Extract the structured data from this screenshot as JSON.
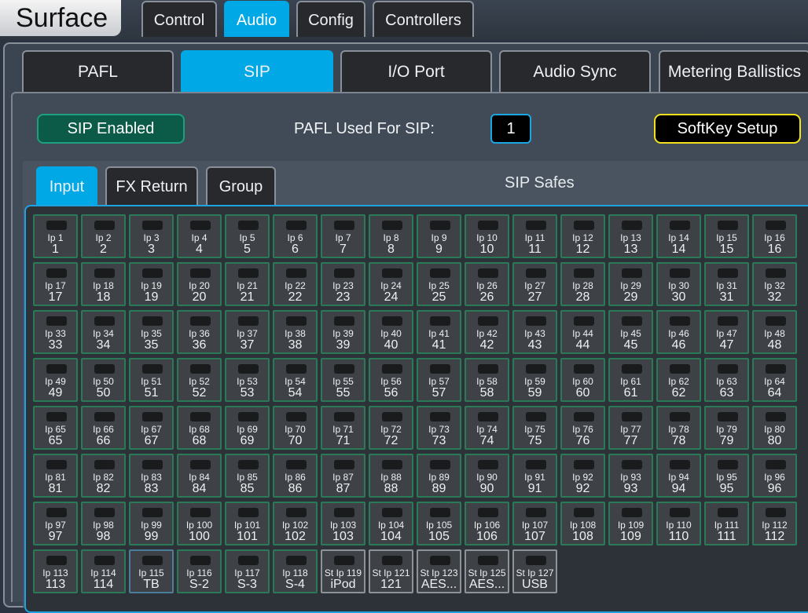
{
  "app": {
    "title": "Surface"
  },
  "top_tabs": [
    "Control",
    "Audio",
    "Config",
    "Controllers"
  ],
  "sub_tabs": [
    "PAFL",
    "SIP",
    "I/O Port",
    "Audio Sync",
    "Metering Ballistics"
  ],
  "sip": {
    "enabled_label": "SIP Enabled",
    "pafl_label": "PAFL Used For SIP:",
    "pafl_value": "1",
    "softkey_label": "SoftKey Setup"
  },
  "safes": {
    "tabs": [
      "Input",
      "FX Return",
      "Group"
    ],
    "title": "SIP Safes"
  },
  "colors": {
    "accent": "#00a8e6",
    "safe_border": "#2a7a57",
    "enabled": "#0b5b48",
    "softkey_border": "#f3e21a"
  },
  "channels": [
    {
      "name": "Ip 1",
      "label": "1"
    },
    {
      "name": "Ip 2",
      "label": "2"
    },
    {
      "name": "Ip 3",
      "label": "3"
    },
    {
      "name": "Ip 4",
      "label": "4"
    },
    {
      "name": "Ip 5",
      "label": "5"
    },
    {
      "name": "Ip 6",
      "label": "6"
    },
    {
      "name": "Ip 7",
      "label": "7"
    },
    {
      "name": "Ip 8",
      "label": "8"
    },
    {
      "name": "Ip 9",
      "label": "9"
    },
    {
      "name": "Ip 10",
      "label": "10"
    },
    {
      "name": "Ip 11",
      "label": "11"
    },
    {
      "name": "Ip 12",
      "label": "12"
    },
    {
      "name": "Ip 13",
      "label": "13"
    },
    {
      "name": "Ip 14",
      "label": "14"
    },
    {
      "name": "Ip 15",
      "label": "15"
    },
    {
      "name": "Ip 16",
      "label": "16"
    },
    {
      "name": "Ip 17",
      "label": "17"
    },
    {
      "name": "Ip 18",
      "label": "18"
    },
    {
      "name": "Ip 19",
      "label": "19"
    },
    {
      "name": "Ip 20",
      "label": "20"
    },
    {
      "name": "Ip 21",
      "label": "21"
    },
    {
      "name": "Ip 22",
      "label": "22"
    },
    {
      "name": "Ip 23",
      "label": "23"
    },
    {
      "name": "Ip 24",
      "label": "24"
    },
    {
      "name": "Ip 25",
      "label": "25"
    },
    {
      "name": "Ip 26",
      "label": "26"
    },
    {
      "name": "Ip 27",
      "label": "27"
    },
    {
      "name": "Ip 28",
      "label": "28"
    },
    {
      "name": "Ip 29",
      "label": "29"
    },
    {
      "name": "Ip 30",
      "label": "30"
    },
    {
      "name": "Ip 31",
      "label": "31"
    },
    {
      "name": "Ip 32",
      "label": "32"
    },
    {
      "name": "Ip 33",
      "label": "33"
    },
    {
      "name": "Ip 34",
      "label": "34"
    },
    {
      "name": "Ip 35",
      "label": "35"
    },
    {
      "name": "Ip 36",
      "label": "36"
    },
    {
      "name": "Ip 37",
      "label": "37"
    },
    {
      "name": "Ip 38",
      "label": "38"
    },
    {
      "name": "Ip 39",
      "label": "39"
    },
    {
      "name": "Ip 40",
      "label": "40"
    },
    {
      "name": "Ip 41",
      "label": "41"
    },
    {
      "name": "Ip 42",
      "label": "42"
    },
    {
      "name": "Ip 43",
      "label": "43"
    },
    {
      "name": "Ip 44",
      "label": "44"
    },
    {
      "name": "Ip 45",
      "label": "45"
    },
    {
      "name": "Ip 46",
      "label": "46"
    },
    {
      "name": "Ip 47",
      "label": "47"
    },
    {
      "name": "Ip 48",
      "label": "48"
    },
    {
      "name": "Ip 49",
      "label": "49"
    },
    {
      "name": "Ip 50",
      "label": "50"
    },
    {
      "name": "Ip 51",
      "label": "51"
    },
    {
      "name": "Ip 52",
      "label": "52"
    },
    {
      "name": "Ip 53",
      "label": "53"
    },
    {
      "name": "Ip 54",
      "label": "54"
    },
    {
      "name": "Ip 55",
      "label": "55"
    },
    {
      "name": "Ip 56",
      "label": "56"
    },
    {
      "name": "Ip 57",
      "label": "57"
    },
    {
      "name": "Ip 58",
      "label": "58"
    },
    {
      "name": "Ip 59",
      "label": "59"
    },
    {
      "name": "Ip 60",
      "label": "60"
    },
    {
      "name": "Ip 61",
      "label": "61"
    },
    {
      "name": "Ip 62",
      "label": "62"
    },
    {
      "name": "Ip 63",
      "label": "63"
    },
    {
      "name": "Ip 64",
      "label": "64"
    },
    {
      "name": "Ip 65",
      "label": "65"
    },
    {
      "name": "Ip 66",
      "label": "66"
    },
    {
      "name": "Ip 67",
      "label": "67"
    },
    {
      "name": "Ip 68",
      "label": "68"
    },
    {
      "name": "Ip 69",
      "label": "69"
    },
    {
      "name": "Ip 70",
      "label": "70"
    },
    {
      "name": "Ip 71",
      "label": "71"
    },
    {
      "name": "Ip 72",
      "label": "72"
    },
    {
      "name": "Ip 73",
      "label": "73"
    },
    {
      "name": "Ip 74",
      "label": "74"
    },
    {
      "name": "Ip 75",
      "label": "75"
    },
    {
      "name": "Ip 76",
      "label": "76"
    },
    {
      "name": "Ip 77",
      "label": "77"
    },
    {
      "name": "Ip 78",
      "label": "78"
    },
    {
      "name": "Ip 79",
      "label": "79"
    },
    {
      "name": "Ip 80",
      "label": "80"
    },
    {
      "name": "Ip 81",
      "label": "81"
    },
    {
      "name": "Ip 82",
      "label": "82"
    },
    {
      "name": "Ip 83",
      "label": "83"
    },
    {
      "name": "Ip 84",
      "label": "84"
    },
    {
      "name": "Ip 85",
      "label": "85"
    },
    {
      "name": "Ip 86",
      "label": "86"
    },
    {
      "name": "Ip 87",
      "label": "87"
    },
    {
      "name": "Ip 88",
      "label": "88"
    },
    {
      "name": "Ip 89",
      "label": "89"
    },
    {
      "name": "Ip 90",
      "label": "90"
    },
    {
      "name": "Ip 91",
      "label": "91"
    },
    {
      "name": "Ip 92",
      "label": "92"
    },
    {
      "name": "Ip 93",
      "label": "93"
    },
    {
      "name": "Ip 94",
      "label": "94"
    },
    {
      "name": "Ip 95",
      "label": "95"
    },
    {
      "name": "Ip 96",
      "label": "96"
    },
    {
      "name": "Ip 97",
      "label": "97"
    },
    {
      "name": "Ip 98",
      "label": "98"
    },
    {
      "name": "Ip 99",
      "label": "99"
    },
    {
      "name": "Ip 100",
      "label": "100"
    },
    {
      "name": "Ip 101",
      "label": "101"
    },
    {
      "name": "Ip 102",
      "label": "102"
    },
    {
      "name": "Ip 103",
      "label": "103"
    },
    {
      "name": "Ip 104",
      "label": "104"
    },
    {
      "name": "Ip 105",
      "label": "105"
    },
    {
      "name": "Ip 106",
      "label": "106"
    },
    {
      "name": "Ip 107",
      "label": "107"
    },
    {
      "name": "Ip 108",
      "label": "108"
    },
    {
      "name": "Ip 109",
      "label": "109"
    },
    {
      "name": "Ip 110",
      "label": "110"
    },
    {
      "name": "Ip 111",
      "label": "111"
    },
    {
      "name": "Ip 112",
      "label": "112"
    },
    {
      "name": "Ip 113",
      "label": "113"
    },
    {
      "name": "Ip 114",
      "label": "114"
    },
    {
      "name": "Ip 115",
      "label": "TB"
    },
    {
      "name": "Ip 116",
      "label": "S-2"
    },
    {
      "name": "Ip 117",
      "label": "S-3"
    },
    {
      "name": "Ip 118",
      "label": "S-4"
    },
    {
      "name": "St Ip 119",
      "label": "iPod"
    },
    {
      "name": "St Ip 121",
      "label": "121"
    },
    {
      "name": "St Ip 123",
      "label": "AES..."
    },
    {
      "name": "St Ip 125",
      "label": "AES..."
    },
    {
      "name": "St Ip 127",
      "label": "USB"
    }
  ]
}
